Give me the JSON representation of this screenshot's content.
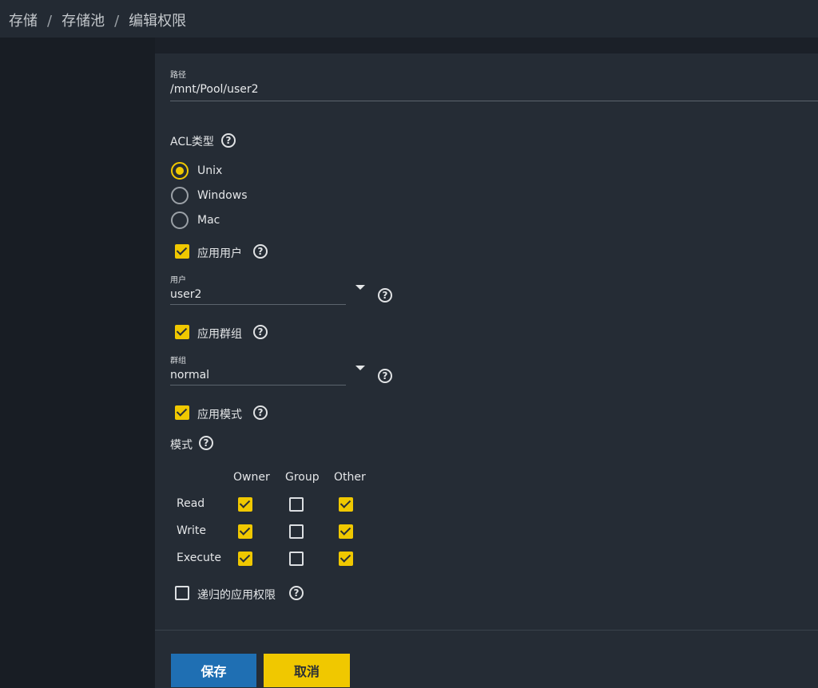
{
  "breadcrumb": {
    "items": [
      "存储",
      "存储池",
      "编辑权限"
    ],
    "separator": "/"
  },
  "path": {
    "label": "路径",
    "value": "/mnt/Pool/user2"
  },
  "acl_type": {
    "label": "ACL类型",
    "options": [
      "Unix",
      "Windows",
      "Mac"
    ],
    "selected": "Unix"
  },
  "apply_user": {
    "label": "应用用户",
    "checked": true
  },
  "user": {
    "label": "用户",
    "value": "user2"
  },
  "apply_group": {
    "label": "应用群组",
    "checked": true
  },
  "group": {
    "label": "群组",
    "value": "normal"
  },
  "apply_mode": {
    "label": "应用模式",
    "checked": true
  },
  "mode": {
    "label": "模式",
    "columns": [
      "Owner",
      "Group",
      "Other"
    ],
    "rows": [
      {
        "label": "Read",
        "owner": true,
        "group": false,
        "other": true
      },
      {
        "label": "Write",
        "owner": true,
        "group": false,
        "other": true
      },
      {
        "label": "Execute",
        "owner": true,
        "group": false,
        "other": true
      }
    ]
  },
  "recursive": {
    "label": "递归的应用权限",
    "checked": false
  },
  "buttons": {
    "save": "保存",
    "cancel": "取消"
  },
  "help_glyph": "?",
  "colors": {
    "accent": "#f0c800",
    "primary": "#1f6fb3",
    "background": "#1b2028",
    "panel": "#252c35"
  }
}
